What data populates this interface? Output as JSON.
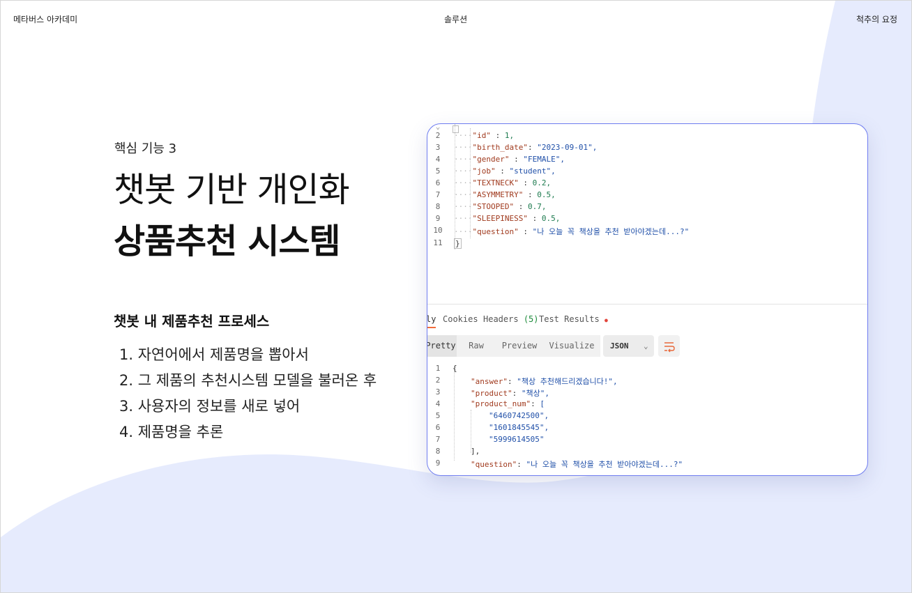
{
  "header": {
    "brand": "메타버스 아카데미",
    "nav": "솔루션",
    "right_link": "척추의 요정"
  },
  "hero": {
    "eyebrow": "핵심 기능 3",
    "title_line1": "챗봇 기반 개인화",
    "title_line2": "상품추천 시스템"
  },
  "process": {
    "title": "챗봇 내 제품추천 프로세스",
    "steps": [
      "1. 자연어에서 제품명을 뽑아서",
      "2. 그 제품의 추천시스템 모델을 불러온 후",
      "3. 사용자의 정보를 새로 넣어",
      "4. 제품명을 추론"
    ]
  },
  "screenshot": {
    "request_lines": [
      {
        "num": "2",
        "key": "\"id\"",
        "sep": " : ",
        "value": "1,",
        "vtype": "n"
      },
      {
        "num": "3",
        "key": "\"birth_date\"",
        "sep": ": ",
        "value": "\"2023-09-01\",",
        "vtype": "s"
      },
      {
        "num": "4",
        "key": "\"gender\"",
        "sep": " : ",
        "value": "\"FEMALE\",",
        "vtype": "s"
      },
      {
        "num": "5",
        "key": "\"job\"",
        "sep": " : ",
        "value": "\"student\",",
        "vtype": "s"
      },
      {
        "num": "6",
        "key": "\"TEXTNECK\"",
        "sep": " : ",
        "value": "0.2,",
        "vtype": "n"
      },
      {
        "num": "7",
        "key": "\"ASYMMETRY\"",
        "sep": " : ",
        "value": "0.5,",
        "vtype": "n"
      },
      {
        "num": "8",
        "key": "\"STOOPED\"",
        "sep": " : ",
        "value": "0.7,",
        "vtype": "n"
      },
      {
        "num": "9",
        "key": "\"SLEEPINESS\"",
        "sep": " : ",
        "value": "0.5,",
        "vtype": "n"
      },
      {
        "num": "10",
        "key": "\"question\"",
        "sep": " : ",
        "value": "\"나 오늘 꼭 책상을 추천 받아야겠는데...?\"",
        "vtype": "s"
      }
    ],
    "request_close_num": "11",
    "request_close": "}",
    "response_tabs": [
      "ly",
      "Cookies",
      "Headers",
      "(5)",
      "Test Results",
      "●"
    ],
    "view_modes": [
      "Pretty",
      "Raw",
      "Preview",
      "Visualize"
    ],
    "format": "JSON",
    "response_lines": [
      {
        "num": "1",
        "text": "{"
      },
      {
        "num": "2",
        "key": "\"answer\"",
        "value": "\"책상 추천해드리겠습니다!\","
      },
      {
        "num": "3",
        "key": "\"product\"",
        "value": "\"책상\","
      },
      {
        "num": "4",
        "key": "\"product_num\"",
        "value": "["
      },
      {
        "num": "5",
        "text": "\"6460742500\","
      },
      {
        "num": "6",
        "text": "\"1601845545\","
      },
      {
        "num": "7",
        "text": "\"5999614505\""
      },
      {
        "num": "8",
        "text": "],"
      },
      {
        "num": "9",
        "key": "\"question\"",
        "value": "\"나 오늘 꼭 책상을 추천 받아야겠는데...?\""
      }
    ]
  },
  "colors": {
    "accent_blue": "#6e7cf0",
    "bg_wave": "#e6ebfd"
  }
}
